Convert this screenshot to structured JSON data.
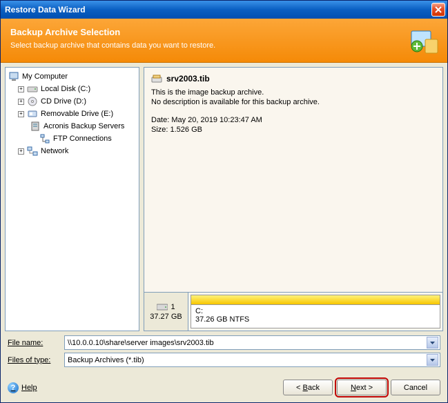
{
  "window": {
    "title": "Restore Data Wizard"
  },
  "header": {
    "subtitle": "Backup Archive Selection",
    "description": "Select backup archive that contains data you want to restore."
  },
  "tree": {
    "root": "My Computer",
    "items": [
      {
        "label": "Local Disk (C:)",
        "expand": "+"
      },
      {
        "label": "CD Drive (D:)",
        "expand": "+"
      },
      {
        "label": "Removable Drive (E:)",
        "expand": "+"
      },
      {
        "label": "Acronis Backup Servers",
        "expand": ""
      },
      {
        "label": "FTP Connections",
        "expand": "",
        "indent": true
      },
      {
        "label": "Network",
        "expand": "+"
      }
    ]
  },
  "file": {
    "name": "srv2003.tib",
    "line1": "This is the image backup archive.",
    "line2": "No description is available for this backup archive.",
    "date_label": "Date: May 20, 2019 10:23:47 AM",
    "size_label": "Size: 1.526 GB"
  },
  "disk": {
    "count": "1",
    "total": "37.27 GB",
    "part_name": "C:",
    "part_desc": "37.26 GB  NTFS"
  },
  "form": {
    "filename_label": "File name:",
    "filename_value": "\\\\10.0.0.10\\share\\server images\\srv2003.tib",
    "filetype_label": "Files of type:",
    "filetype_value": "Backup Archives (*.tib)"
  },
  "footer": {
    "help": "Help",
    "back": "Back",
    "next": "Next",
    "cancel": "Cancel"
  }
}
